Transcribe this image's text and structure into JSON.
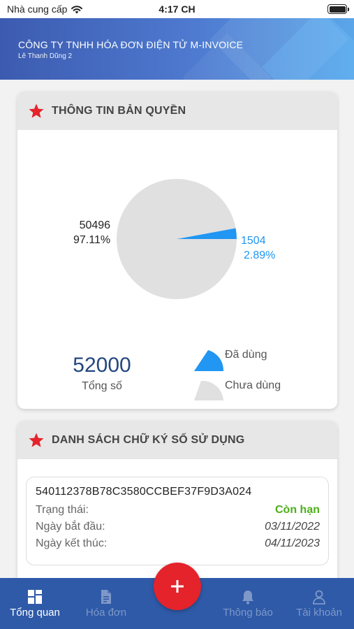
{
  "status_bar": {
    "carrier": "Nhà cung cấp",
    "time": "4:17 CH"
  },
  "header": {
    "company": "CÔNG TY TNHH HÓA ĐƠN ĐIỆN TỬ M-INVOICE",
    "user": "Lê Thanh Dũng 2"
  },
  "license_card": {
    "title": "THÔNG TIN BẢN QUYỀN",
    "icon": "star-icon",
    "total_value": "52000",
    "total_label": "Tổng số",
    "legend": [
      {
        "label": "Đã dùng",
        "color": "#2196f3"
      },
      {
        "label": "Chưa dùng",
        "color": "#e0e0e0"
      }
    ]
  },
  "chart_data": {
    "type": "pie",
    "slices": [
      {
        "name": "Đã dùng",
        "value": 1504,
        "percent_label": "2.89%",
        "color": "#2196f3"
      },
      {
        "name": "Chưa dùng",
        "value": 50496,
        "percent_label": "97.11%",
        "color": "#e0e0e0"
      }
    ],
    "total": 52000
  },
  "signature_card": {
    "title": "DANH SÁCH CHỮ KÝ SỐ SỬ DỤNG",
    "icon": "star-icon",
    "certificates": [
      {
        "serial": "540112378B78C3580CCBEF37F9D3A024",
        "status_label": "Trạng thái:",
        "status_value": "Còn hạn",
        "start_label": "Ngày bắt đầu:",
        "start_value": "03/11/2022",
        "end_label": "Ngày kết thúc:",
        "end_value": "04/11/2023"
      }
    ]
  },
  "tabbar": {
    "tabs": [
      {
        "label": "Tổng quan",
        "icon": "dashboard-icon",
        "active": true
      },
      {
        "label": "Hóa đơn",
        "icon": "document-icon",
        "active": false
      },
      {
        "label": "Thông báo",
        "icon": "bell-icon",
        "active": false
      },
      {
        "label": "Tài khoản",
        "icon": "user-icon",
        "active": false
      }
    ],
    "fab_icon": "plus-icon"
  },
  "colors": {
    "header_start": "#3c5bb0",
    "header_end": "#5aa6e8",
    "tabbar": "#2e5aa8",
    "fab": "#e4232b",
    "accent_blue": "#2196f3",
    "valid_green": "#4caf1a"
  }
}
